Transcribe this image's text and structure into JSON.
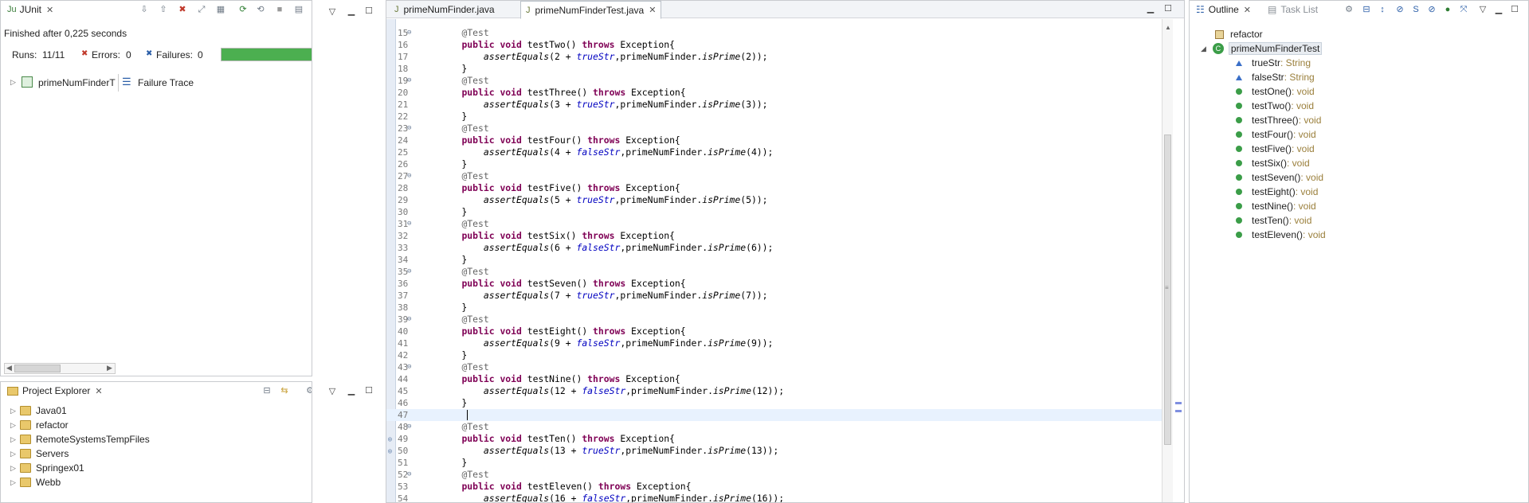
{
  "junit": {
    "tab_label": "JUnit",
    "status": "Finished after 0,225 seconds",
    "runs_label": "Runs:",
    "runs_value": "11/11",
    "errors_label": "Errors:",
    "errors_value": "0",
    "failures_label": "Failures:",
    "failures_value": "0",
    "progress": 1.0,
    "tree_item": "primeNumFinderT",
    "failure_trace_label": "Failure Trace"
  },
  "explorer": {
    "tab_label": "Project Explorer",
    "items": [
      "Java01",
      "refactor",
      "RemoteSystemsTempFiles",
      "Servers",
      "Springex01",
      "Webb"
    ]
  },
  "editor": {
    "tabs": [
      "primeNumFinder.java",
      "primeNumFinderTest.java"
    ],
    "lines": [
      {
        "n": "15",
        "t": "    @Test"
      },
      {
        "n": "16",
        "t": "    public void testTwo() throws Exception{"
      },
      {
        "n": "17",
        "t": "        assertEquals(2 + trueStr,primeNumFinder.isPrime(2));"
      },
      {
        "n": "18",
        "t": "    }"
      },
      {
        "n": "19",
        "t": "    @Test"
      },
      {
        "n": "20",
        "t": "    public void testThree() throws Exception{"
      },
      {
        "n": "21",
        "t": "        assertEquals(3 + trueStr,primeNumFinder.isPrime(3));"
      },
      {
        "n": "22",
        "t": "    }"
      },
      {
        "n": "23",
        "t": "    @Test"
      },
      {
        "n": "24",
        "t": "    public void testFour() throws Exception{"
      },
      {
        "n": "25",
        "t": "        assertEquals(4 + falseStr,primeNumFinder.isPrime(4));"
      },
      {
        "n": "26",
        "t": "    }"
      },
      {
        "n": "27",
        "t": "    @Test"
      },
      {
        "n": "28",
        "t": "    public void testFive() throws Exception{"
      },
      {
        "n": "29",
        "t": "        assertEquals(5 + trueStr,primeNumFinder.isPrime(5));"
      },
      {
        "n": "30",
        "t": "    }"
      },
      {
        "n": "31",
        "t": "    @Test"
      },
      {
        "n": "32",
        "t": "    public void testSix() throws Exception{"
      },
      {
        "n": "33",
        "t": "        assertEquals(6 + falseStr,primeNumFinder.isPrime(6));"
      },
      {
        "n": "34",
        "t": "    }"
      },
      {
        "n": "35",
        "t": "    @Test"
      },
      {
        "n": "36",
        "t": "    public void testSeven() throws Exception{"
      },
      {
        "n": "37",
        "t": "        assertEquals(7 + trueStr,primeNumFinder.isPrime(7));"
      },
      {
        "n": "38",
        "t": "    }"
      },
      {
        "n": "39",
        "t": "    @Test"
      },
      {
        "n": "40",
        "t": "    public void testEight() throws Exception{"
      },
      {
        "n": "41",
        "t": "        assertEquals(9 + falseStr,primeNumFinder.isPrime(9));"
      },
      {
        "n": "42",
        "t": "    }"
      },
      {
        "n": "43",
        "t": "    @Test"
      },
      {
        "n": "44",
        "t": "    public void testNine() throws Exception{"
      },
      {
        "n": "45",
        "t": "        assertEquals(12 + falseStr,primeNumFinder.isPrime(12));"
      },
      {
        "n": "46",
        "t": "    }"
      },
      {
        "n": "47",
        "t": "    "
      },
      {
        "n": "48",
        "t": "    @Test"
      },
      {
        "n": "49",
        "t": "    public void testTen() throws Exception{"
      },
      {
        "n": "50",
        "t": "        assertEquals(13 + trueStr,primeNumFinder.isPrime(13));"
      },
      {
        "n": "51",
        "t": "    }"
      },
      {
        "n": "52",
        "t": "    @Test"
      },
      {
        "n": "53",
        "t": "    public void testEleven() throws Exception{"
      },
      {
        "n": "54",
        "t": "        assertEquals(16 + falseStr,primeNumFinder.isPrime(16));"
      }
    ]
  },
  "outline": {
    "tab_label": "Outline",
    "tasks_label": "Task List",
    "package": "refactor",
    "class": "primeNumFinderTest",
    "fields": [
      {
        "name": "trueStr",
        "type": " : String"
      },
      {
        "name": "falseStr",
        "type": " : String"
      }
    ],
    "methods": [
      {
        "name": "testOne()",
        "type": " : void"
      },
      {
        "name": "testTwo()",
        "type": " : void"
      },
      {
        "name": "testThree()",
        "type": " : void"
      },
      {
        "name": "testFour()",
        "type": " : void"
      },
      {
        "name": "testFive()",
        "type": " : void"
      },
      {
        "name": "testSix()",
        "type": " : void"
      },
      {
        "name": "testSeven()",
        "type": " : void"
      },
      {
        "name": "testEight()",
        "type": " : void"
      },
      {
        "name": "testNine()",
        "type": " : void"
      },
      {
        "name": "testTen()",
        "type": " : void"
      },
      {
        "name": "testEleven()",
        "type": " : void"
      }
    ]
  }
}
